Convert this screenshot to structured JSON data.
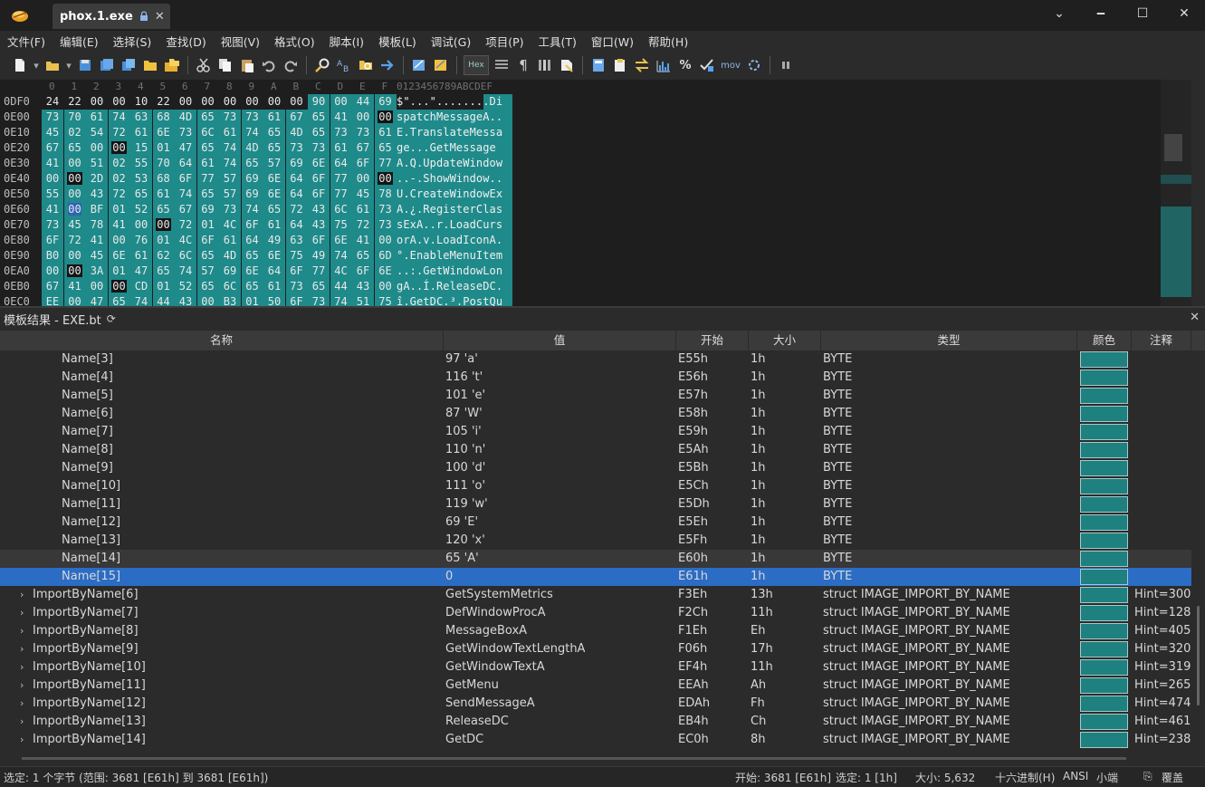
{
  "window": {
    "tab_title": "phox.1.exe",
    "minimize": "🗕",
    "restore": "☐",
    "close": "✕",
    "expand": "⌄"
  },
  "menu": [
    "文件(F)",
    "编辑(E)",
    "选择(S)",
    "查找(D)",
    "视图(V)",
    "格式(O)",
    "脚本(I)",
    "模板(L)",
    "调试(G)",
    "项目(P)",
    "工具(T)",
    "窗口(W)",
    "帮助(H)"
  ],
  "toolbar": {
    "hex_label": "Hex",
    "mov_label": "mov"
  },
  "hex": {
    "col_headers": [
      "0",
      "1",
      "2",
      "3",
      "4",
      "5",
      "6",
      "7",
      "8",
      "9",
      "A",
      "B",
      "C",
      "D",
      "E",
      "F"
    ],
    "ascii_header": "0123456789ABCDEF",
    "rows": [
      {
        "addr": "0DF0",
        "bytes": [
          "24",
          "22",
          "00",
          "00",
          "10",
          "22",
          "00",
          "00",
          "00",
          "00",
          "00",
          "00",
          "90",
          "00",
          "44",
          "69"
        ],
        "teal_from": 12,
        "zeros": [],
        "ascii": "$\"...\"........Di"
      },
      {
        "addr": "0E00",
        "bytes": [
          "73",
          "70",
          "61",
          "74",
          "63",
          "68",
          "4D",
          "65",
          "73",
          "73",
          "61",
          "67",
          "65",
          "41",
          "00",
          "00"
        ],
        "teal_from": 0,
        "zeros": [
          15
        ],
        "ascii": "spatchMessageA.."
      },
      {
        "addr": "0E10",
        "bytes": [
          "45",
          "02",
          "54",
          "72",
          "61",
          "6E",
          "73",
          "6C",
          "61",
          "74",
          "65",
          "4D",
          "65",
          "73",
          "73",
          "61"
        ],
        "teal_from": 0,
        "zeros": [],
        "ascii": "E.TranslateMessa"
      },
      {
        "addr": "0E20",
        "bytes": [
          "67",
          "65",
          "00",
          "00",
          "15",
          "01",
          "47",
          "65",
          "74",
          "4D",
          "65",
          "73",
          "73",
          "61",
          "67",
          "65"
        ],
        "teal_from": 0,
        "zeros": [
          3
        ],
        "ascii": "ge...GetMessage"
      },
      {
        "addr": "0E30",
        "bytes": [
          "41",
          "00",
          "51",
          "02",
          "55",
          "70",
          "64",
          "61",
          "74",
          "65",
          "57",
          "69",
          "6E",
          "64",
          "6F",
          "77"
        ],
        "teal_from": 0,
        "zeros": [],
        "ascii": "A.Q.UpdateWindow"
      },
      {
        "addr": "0E40",
        "bytes": [
          "00",
          "00",
          "2D",
          "02",
          "53",
          "68",
          "6F",
          "77",
          "57",
          "69",
          "6E",
          "64",
          "6F",
          "77",
          "00",
          "00"
        ],
        "teal_from": 0,
        "zeros": [
          1,
          15
        ],
        "ascii": "..-.ShowWindow.."
      },
      {
        "addr": "0E50",
        "bytes": [
          "55",
          "00",
          "43",
          "72",
          "65",
          "61",
          "74",
          "65",
          "57",
          "69",
          "6E",
          "64",
          "6F",
          "77",
          "45",
          "78"
        ],
        "teal_from": 0,
        "zeros": [],
        "ascii": "U.CreateWindowEx"
      },
      {
        "addr": "0E60",
        "bytes": [
          "41",
          "00",
          "BF",
          "01",
          "52",
          "65",
          "67",
          "69",
          "73",
          "74",
          "65",
          "72",
          "43",
          "6C",
          "61",
          "73"
        ],
        "teal_from": 0,
        "zeros": [],
        "sel": [
          1
        ],
        "ascii": "A.¿.RegisterClas"
      },
      {
        "addr": "0E70",
        "bytes": [
          "73",
          "45",
          "78",
          "41",
          "00",
          "00",
          "72",
          "01",
          "4C",
          "6F",
          "61",
          "64",
          "43",
          "75",
          "72",
          "73"
        ],
        "teal_from": 0,
        "zeros": [
          5
        ],
        "ascii": "sExA..r.LoadCurs"
      },
      {
        "addr": "0E80",
        "bytes": [
          "6F",
          "72",
          "41",
          "00",
          "76",
          "01",
          "4C",
          "6F",
          "61",
          "64",
          "49",
          "63",
          "6F",
          "6E",
          "41",
          "00"
        ],
        "teal_from": 0,
        "zeros": [],
        "ascii": "orA.v.LoadIconA."
      },
      {
        "addr": "0E90",
        "bytes": [
          "B0",
          "00",
          "45",
          "6E",
          "61",
          "62",
          "6C",
          "65",
          "4D",
          "65",
          "6E",
          "75",
          "49",
          "74",
          "65",
          "6D"
        ],
        "teal_from": 0,
        "zeros": [],
        "ascii": "°.EnableMenuItem"
      },
      {
        "addr": "0EA0",
        "bytes": [
          "00",
          "00",
          "3A",
          "01",
          "47",
          "65",
          "74",
          "57",
          "69",
          "6E",
          "64",
          "6F",
          "77",
          "4C",
          "6F",
          "6E"
        ],
        "teal_from": 0,
        "zeros": [
          1
        ],
        "ascii": "..:.GetWindowLon"
      },
      {
        "addr": "0EB0",
        "bytes": [
          "67",
          "41",
          "00",
          "00",
          "CD",
          "01",
          "52",
          "65",
          "6C",
          "65",
          "61",
          "73",
          "65",
          "44",
          "43",
          "00"
        ],
        "teal_from": 0,
        "zeros": [
          3
        ],
        "ascii": "gA..Í.ReleaseDC."
      },
      {
        "addr": "0EC0",
        "bytes": [
          "EE",
          "00",
          "47",
          "65",
          "74",
          "44",
          "43",
          "00",
          "B3",
          "01",
          "50",
          "6F",
          "73",
          "74",
          "51",
          "75"
        ],
        "teal_from": 0,
        "zeros": [],
        "ascii": "î.GetDC.³.PostQu"
      }
    ]
  },
  "template": {
    "title": "模板结果 - EXE.bt",
    "columns": {
      "name": "名称",
      "value": "值",
      "start": "开始",
      "size": "大小",
      "type": "类型",
      "color": "颜色",
      "comment": "注释"
    },
    "rows": [
      {
        "name": "Name[3]",
        "value": "97 'a'",
        "start": "E55h",
        "size": "1h",
        "type": "BYTE",
        "comment": "",
        "indent": 2
      },
      {
        "name": "Name[4]",
        "value": "116 't'",
        "start": "E56h",
        "size": "1h",
        "type": "BYTE",
        "comment": "",
        "indent": 2
      },
      {
        "name": "Name[5]",
        "value": "101 'e'",
        "start": "E57h",
        "size": "1h",
        "type": "BYTE",
        "comment": "",
        "indent": 2
      },
      {
        "name": "Name[6]",
        "value": "87 'W'",
        "start": "E58h",
        "size": "1h",
        "type": "BYTE",
        "comment": "",
        "indent": 2
      },
      {
        "name": "Name[7]",
        "value": "105 'i'",
        "start": "E59h",
        "size": "1h",
        "type": "BYTE",
        "comment": "",
        "indent": 2
      },
      {
        "name": "Name[8]",
        "value": "110 'n'",
        "start": "E5Ah",
        "size": "1h",
        "type": "BYTE",
        "comment": "",
        "indent": 2
      },
      {
        "name": "Name[9]",
        "value": "100 'd'",
        "start": "E5Bh",
        "size": "1h",
        "type": "BYTE",
        "comment": "",
        "indent": 2
      },
      {
        "name": "Name[10]",
        "value": "111 'o'",
        "start": "E5Ch",
        "size": "1h",
        "type": "BYTE",
        "comment": "",
        "indent": 2
      },
      {
        "name": "Name[11]",
        "value": "119 'w'",
        "start": "E5Dh",
        "size": "1h",
        "type": "BYTE",
        "comment": "",
        "indent": 2
      },
      {
        "name": "Name[12]",
        "value": "69 'E'",
        "start": "E5Eh",
        "size": "1h",
        "type": "BYTE",
        "comment": "",
        "indent": 2
      },
      {
        "name": "Name[13]",
        "value": "120 'x'",
        "start": "E5Fh",
        "size": "1h",
        "type": "BYTE",
        "comment": "",
        "indent": 2
      },
      {
        "name": "Name[14]",
        "value": "65 'A'",
        "start": "E60h",
        "size": "1h",
        "type": "BYTE",
        "comment": "",
        "indent": 2
      },
      {
        "name": "Name[15]",
        "value": "0",
        "start": "E61h",
        "size": "1h",
        "type": "BYTE",
        "comment": "",
        "indent": 2,
        "selected": true
      },
      {
        "name": "ImportByName[6]",
        "value": "GetSystemMetrics",
        "start": "F3Eh",
        "size": "13h",
        "type": "struct IMAGE_IMPORT_BY_NAME",
        "comment": "Hint=300,",
        "indent": 1
      },
      {
        "name": "ImportByName[7]",
        "value": "DefWindowProcA",
        "start": "F2Ch",
        "size": "11h",
        "type": "struct IMAGE_IMPORT_BY_NAME",
        "comment": "Hint=128,",
        "indent": 1
      },
      {
        "name": "ImportByName[8]",
        "value": "MessageBoxA",
        "start": "F1Eh",
        "size": "Eh",
        "type": "struct IMAGE_IMPORT_BY_NAME",
        "comment": "Hint=405,",
        "indent": 1
      },
      {
        "name": "ImportByName[9]",
        "value": "GetWindowTextLengthA",
        "start": "F06h",
        "size": "17h",
        "type": "struct IMAGE_IMPORT_BY_NAME",
        "comment": "Hint=320,",
        "indent": 1
      },
      {
        "name": "ImportByName[10]",
        "value": "GetWindowTextA",
        "start": "EF4h",
        "size": "11h",
        "type": "struct IMAGE_IMPORT_BY_NAME",
        "comment": "Hint=319,",
        "indent": 1
      },
      {
        "name": "ImportByName[11]",
        "value": "GetMenu",
        "start": "EEAh",
        "size": "Ah",
        "type": "struct IMAGE_IMPORT_BY_NAME",
        "comment": "Hint=265,",
        "indent": 1
      },
      {
        "name": "ImportByName[12]",
        "value": "SendMessageA",
        "start": "EDAh",
        "size": "Fh",
        "type": "struct IMAGE_IMPORT_BY_NAME",
        "comment": "Hint=474,",
        "indent": 1
      },
      {
        "name": "ImportByName[13]",
        "value": "ReleaseDC",
        "start": "EB4h",
        "size": "Ch",
        "type": "struct IMAGE_IMPORT_BY_NAME",
        "comment": "Hint=461,",
        "indent": 1
      },
      {
        "name": "ImportByName[14]",
        "value": "GetDC",
        "start": "EC0h",
        "size": "8h",
        "type": "struct IMAGE_IMPORT_BY_NAME",
        "comment": "Hint=238,",
        "indent": 1
      }
    ]
  },
  "status": {
    "selection": "选定: 1 个字节 (范围: 3681 [E61h] 到 3681 [E61h])",
    "start": "开始: 3681 [E61h]",
    "selected": "选定: 1 [1h]",
    "size": "大小: 5,632",
    "mode": "十六进制(H)",
    "encoding": "ANSI",
    "endian": "小端",
    "overwrite": "覆盖"
  },
  "colors": {
    "teal": "#1f8a8a",
    "selection": "#2b6cc4",
    "background": "#1e1e1e"
  },
  "icons": [
    "new-file-icon",
    "open-folder-icon",
    "save-icon",
    "save-as-icon",
    "save-all-icon",
    "folder-icon",
    "workspace-icon",
    "cut-icon",
    "copy-icon",
    "paste-icon",
    "undo-icon",
    "redo-icon",
    "find-icon",
    "replace-icon",
    "find-in-files-icon",
    "goto-icon",
    "template-icon",
    "script-icon",
    "hex-toggle-icon",
    "columns-icon",
    "pilcrow-icon",
    "list-icon",
    "bookmark-icon",
    "calculator-icon",
    "inspector-icon",
    "compare-icon",
    "histogram-icon",
    "percent-icon",
    "checksum-icon",
    "disassembler-icon",
    "process-icon",
    "pause-icon"
  ]
}
